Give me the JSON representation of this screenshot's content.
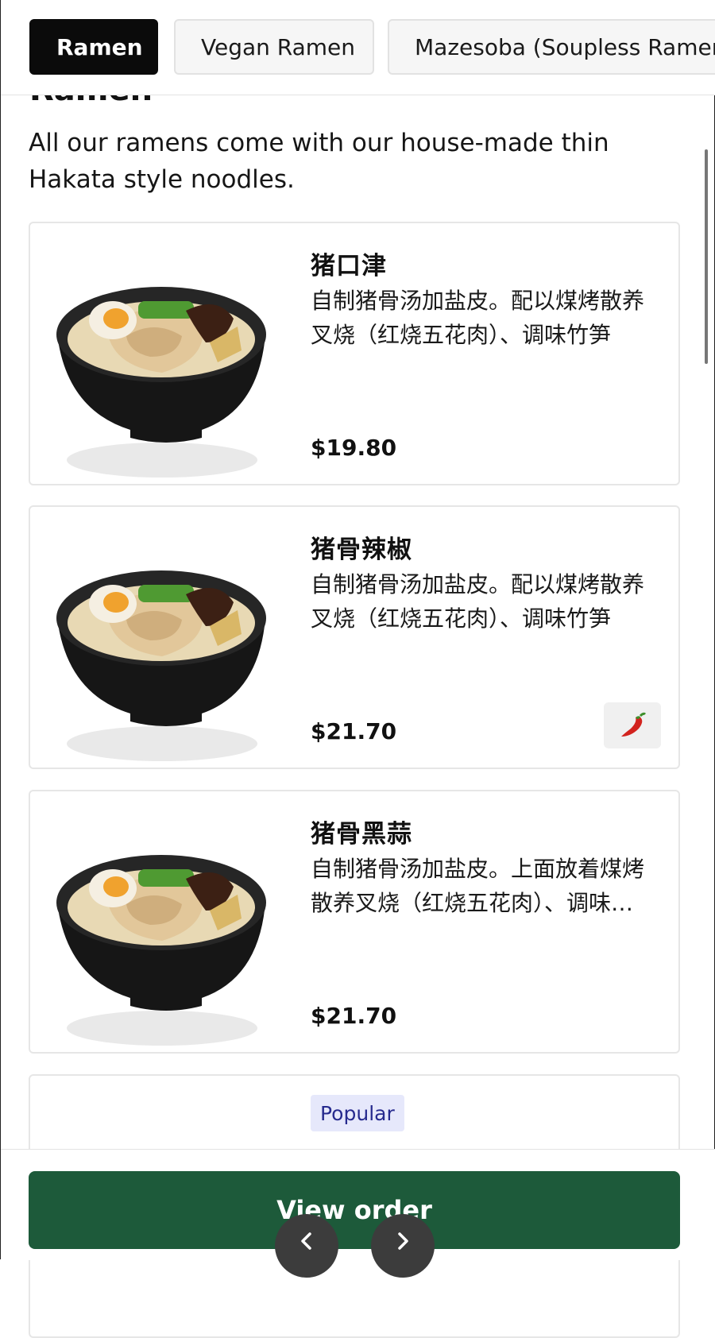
{
  "tabs": [
    {
      "label": "Ramen",
      "active": true
    },
    {
      "label": "Vegan Ramen",
      "active": false
    },
    {
      "label": "Mazesoba (Soupless Ramen)",
      "active": false
    }
  ],
  "section": {
    "title": "Ramen",
    "description": "All our ramens come with our house-made thin Hakata style noodles."
  },
  "items": [
    {
      "name": "猪口津",
      "description": "自制猪骨汤加盐皮。配以煤烤散养叉烧（红烧五花肉）、调味竹笋",
      "price": "$19.80",
      "spicy": false
    },
    {
      "name": "猪骨辣椒",
      "description": "自制猪骨汤加盐皮。配以煤烤散养叉烧（红烧五花肉）、调味竹笋",
      "price": "$21.70",
      "spicy": true,
      "spicy_icon": "chili-pepper-icon"
    },
    {
      "name": "猪骨黑蒜",
      "description": "自制猪骨汤加盐皮。上面放着煤烤散养叉烧（红烧五花肉）、调味竹笋",
      "price": "$21.70",
      "spicy": false
    }
  ],
  "partial_item": {
    "badge": "Popular"
  },
  "footer": {
    "view_order_label": "View order"
  },
  "colors": {
    "primary_button": "#1d5a3a",
    "active_tab": "#0b0b0b",
    "badge_bg": "#e6e8fb",
    "badge_text": "#262a8e"
  }
}
